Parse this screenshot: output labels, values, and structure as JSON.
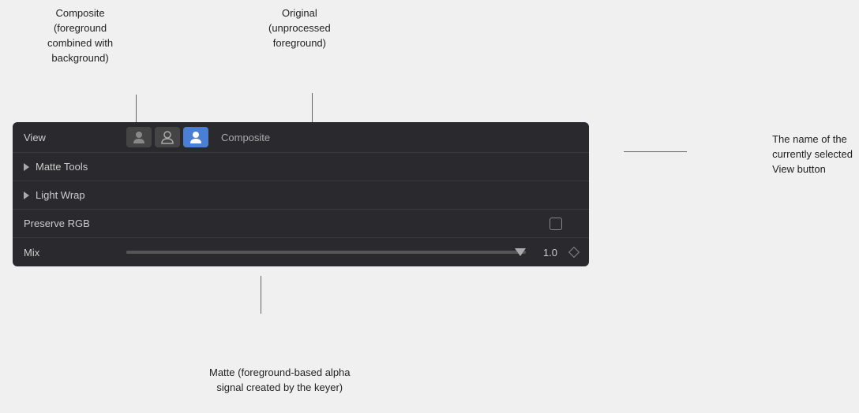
{
  "annotations": {
    "composite_label": "Composite\n(foreground\ncombined with\nbackground)",
    "original_label": "Original\n(unprocessed\nforeground)",
    "matte_label": "Matte (foreground-based alpha\nsignal created by the keyer)",
    "view_name_label": "The name of the\ncurrently selected\nView button",
    "view_name_value": "Composite"
  },
  "panel": {
    "view_row": {
      "label": "View",
      "composite_name": "Composite",
      "buttons": [
        {
          "id": "matte",
          "active": false,
          "title": "Matte"
        },
        {
          "id": "original",
          "active": false,
          "title": "Original"
        },
        {
          "id": "composite",
          "active": true,
          "title": "Composite"
        }
      ]
    },
    "matte_tools_row": {
      "label": "Matte Tools"
    },
    "light_wrap_row": {
      "label": "Light Wrap"
    },
    "preserve_rgb_row": {
      "label": "Preserve RGB"
    },
    "mix_row": {
      "label": "Mix",
      "value": "1.0"
    }
  }
}
